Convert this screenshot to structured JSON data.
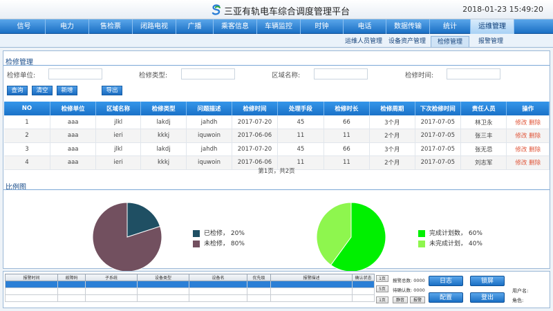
{
  "header": {
    "title": "三亚有轨电车综合调度管理平台",
    "datetime": "2018-01-23 15:49:20"
  },
  "nav": {
    "items": [
      {
        "label": "信号"
      },
      {
        "label": "电力"
      },
      {
        "label": "售检票"
      },
      {
        "label": "闭路电视"
      },
      {
        "label": "广播"
      },
      {
        "label": "乘客信息"
      },
      {
        "label": "车辆监控"
      },
      {
        "label": "时钟"
      },
      {
        "label": "电话"
      },
      {
        "label": "数据传输"
      },
      {
        "label": "统计"
      },
      {
        "label": "运维管理"
      }
    ]
  },
  "subnav": {
    "items": [
      {
        "label": "运维人员管理"
      },
      {
        "label": "设备资产管理"
      },
      {
        "label": "检修管理"
      },
      {
        "label": "报警管理"
      }
    ]
  },
  "repair": {
    "section_title": "检修管理",
    "filters": {
      "unit_label": "检修单位:",
      "unit_value": "",
      "type_label": "检修类型:",
      "type_value": "",
      "area_label": "区域名称:",
      "area_value": "",
      "time_label": "检修时间:",
      "time_value": ""
    },
    "buttons": {
      "query": "查询",
      "clear": "清空",
      "add": "新增",
      "export": "导出"
    },
    "columns": [
      "NO",
      "检修单位",
      "区域名称",
      "检修类型",
      "问题描述",
      "检修时间",
      "处理手段",
      "检修时长",
      "检修周期",
      "下次检修时间",
      "责任人员",
      "操作"
    ],
    "rows": [
      {
        "no": "1",
        "unit": "aaa",
        "area": "jlkl",
        "type": "lakdj",
        "desc": "jahdh",
        "time": "2017-07-20",
        "method": "45",
        "duration": "66",
        "cycle": "3个月",
        "next": "2017-07-05",
        "person": "林卫永",
        "person_highlight": true,
        "edit": "修改",
        "delete": "删除"
      },
      {
        "no": "2",
        "unit": "aaa",
        "area": "ieri",
        "type": "kkkj",
        "desc": "iquwoin",
        "time": "2017-06-06",
        "method": "11",
        "duration": "11",
        "cycle": "2个月",
        "next": "2017-07-05",
        "person": "张三丰",
        "person_highlight": false,
        "edit": "修改",
        "delete": "删除"
      },
      {
        "no": "3",
        "unit": "aaa",
        "area": "jlkl",
        "type": "lakdj",
        "desc": "jahdh",
        "time": "2017-07-20",
        "method": "45",
        "duration": "66",
        "cycle": "3个月",
        "next": "2017-07-05",
        "person": "张无忌",
        "person_highlight": true,
        "edit": "修改",
        "delete": "删除"
      },
      {
        "no": "4",
        "unit": "aaa",
        "area": "ieri",
        "type": "kkkj",
        "desc": "iquwoin",
        "time": "2017-06-06",
        "method": "11",
        "duration": "11",
        "cycle": "2个月",
        "next": "2017-07-05",
        "person": "刘志军",
        "person_highlight": false,
        "edit": "修改",
        "delete": "删除"
      }
    ],
    "pager": "第1页，共2页"
  },
  "ratio": {
    "section_title": "比例图"
  },
  "chart_data": [
    {
      "type": "pie",
      "title": "",
      "categories": [
        "已检修",
        "未检修"
      ],
      "values": [
        20,
        80
      ],
      "colors": [
        "#1f4f63",
        "#72505f"
      ],
      "legend_labels": [
        "已检修， 20%",
        "未检修， 80%"
      ],
      "legend": "right"
    },
    {
      "type": "pie",
      "title": "",
      "categories": [
        "完成计划数",
        "未完成计划"
      ],
      "values": [
        60,
        40
      ],
      "colors": [
        "#00f000",
        "#8ef64e"
      ],
      "legend_labels": [
        "完成计划数， 60%",
        "未完成计划， 40%"
      ],
      "legend": "right"
    }
  ],
  "alarm_panel": {
    "columns": [
      "报警时间",
      "故障码",
      "子系统",
      "设备类型",
      "设备名",
      "优先级",
      "报警描述",
      "确认状态"
    ],
    "row_count": 3,
    "selected_row": 0,
    "side_buttons": [
      "1页",
      "5页",
      "1页"
    ],
    "total_label": "报警总数: 0000",
    "confirmed_label": "待确认数: 0000",
    "mute_label": "静音",
    "alarm_label": "报警",
    "buttons": {
      "log": "日志",
      "lock": "锁屏",
      "config": "配置",
      "logout": "登出"
    },
    "user_label": "用户名:",
    "role_label": "角色:"
  },
  "colors": {
    "nav_blue": "#1a6fc4",
    "table_header": "#1f7fd8",
    "highlight_red": "#e0563a",
    "logo_green": "#2eaa3c",
    "logo_blue": "#2d7fd6"
  },
  "icons": {
    "logo": "s-swirl-logo-icon"
  }
}
